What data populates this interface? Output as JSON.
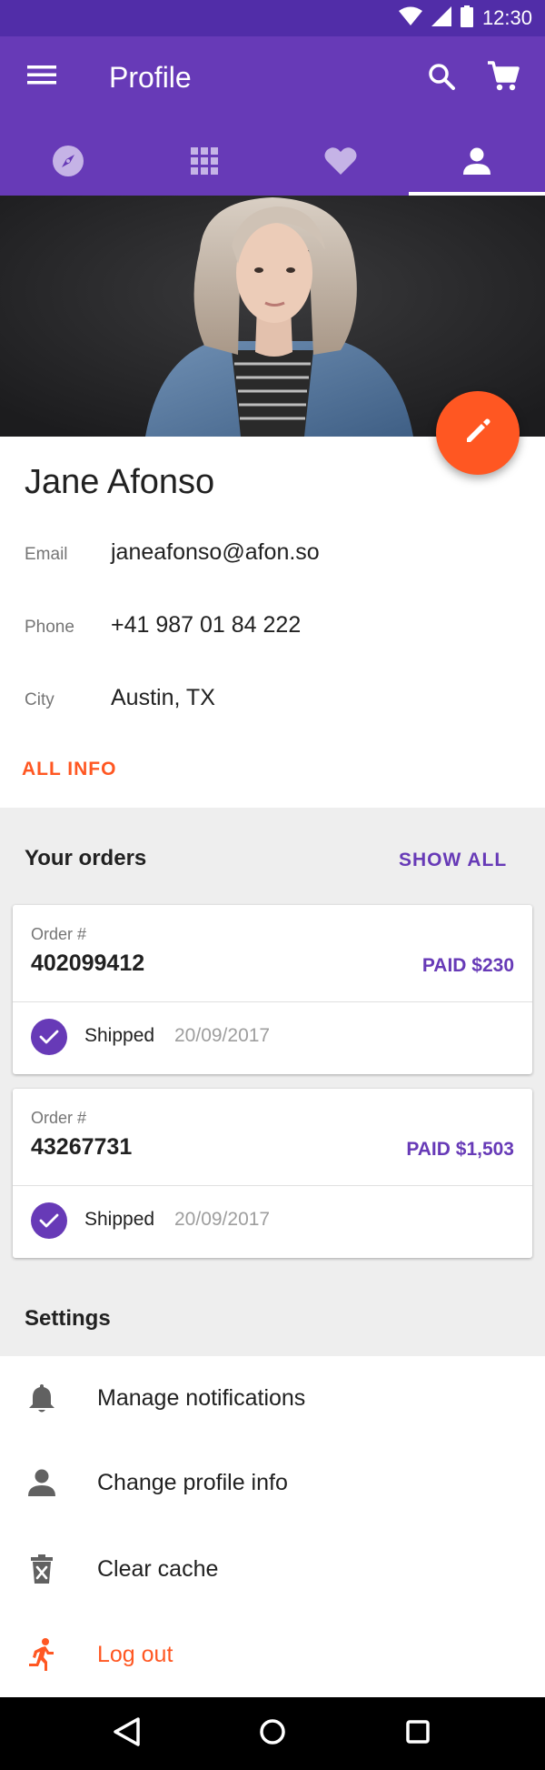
{
  "status_bar": {
    "time": "12:30"
  },
  "app_bar": {
    "title": "Profile",
    "tabs": [
      {
        "icon": "compass-icon"
      },
      {
        "icon": "grid-icon"
      },
      {
        "icon": "heart-icon"
      },
      {
        "icon": "person-icon",
        "selected": true
      }
    ]
  },
  "profile": {
    "name": "Jane Afonso",
    "fields": [
      {
        "label": "Email",
        "value": "janeafonso@afon.so"
      },
      {
        "label": "Phone",
        "value": "+41 987 01 84 222"
      },
      {
        "label": "City",
        "value": "Austin, TX"
      }
    ],
    "all_info_label": "ALL INFO",
    "fab_icon": "pencil-icon"
  },
  "orders": {
    "title": "Your orders",
    "show_all_label": "SHOW ALL",
    "items": [
      {
        "label": "Order #",
        "number": "402099412",
        "paid": "PAID $230",
        "status": "Shipped",
        "date": "20/09/2017"
      },
      {
        "label": "Order #",
        "number": "43267731",
        "paid": "PAID $1,503",
        "status": "Shipped",
        "date": "20/09/2017"
      }
    ]
  },
  "settings": {
    "title": "Settings",
    "items": [
      {
        "label": "Manage notifications",
        "icon": "bell-icon"
      },
      {
        "label": "Change profile info",
        "icon": "person-icon"
      },
      {
        "label": "Clear cache",
        "icon": "trash-icon"
      },
      {
        "label": "Log out",
        "icon": "running-person-icon"
      }
    ]
  },
  "colors": {
    "primary": "#673ab7",
    "primary_dark": "#512da8",
    "accent": "#ff5722",
    "section_bg": "#eeeeee"
  }
}
